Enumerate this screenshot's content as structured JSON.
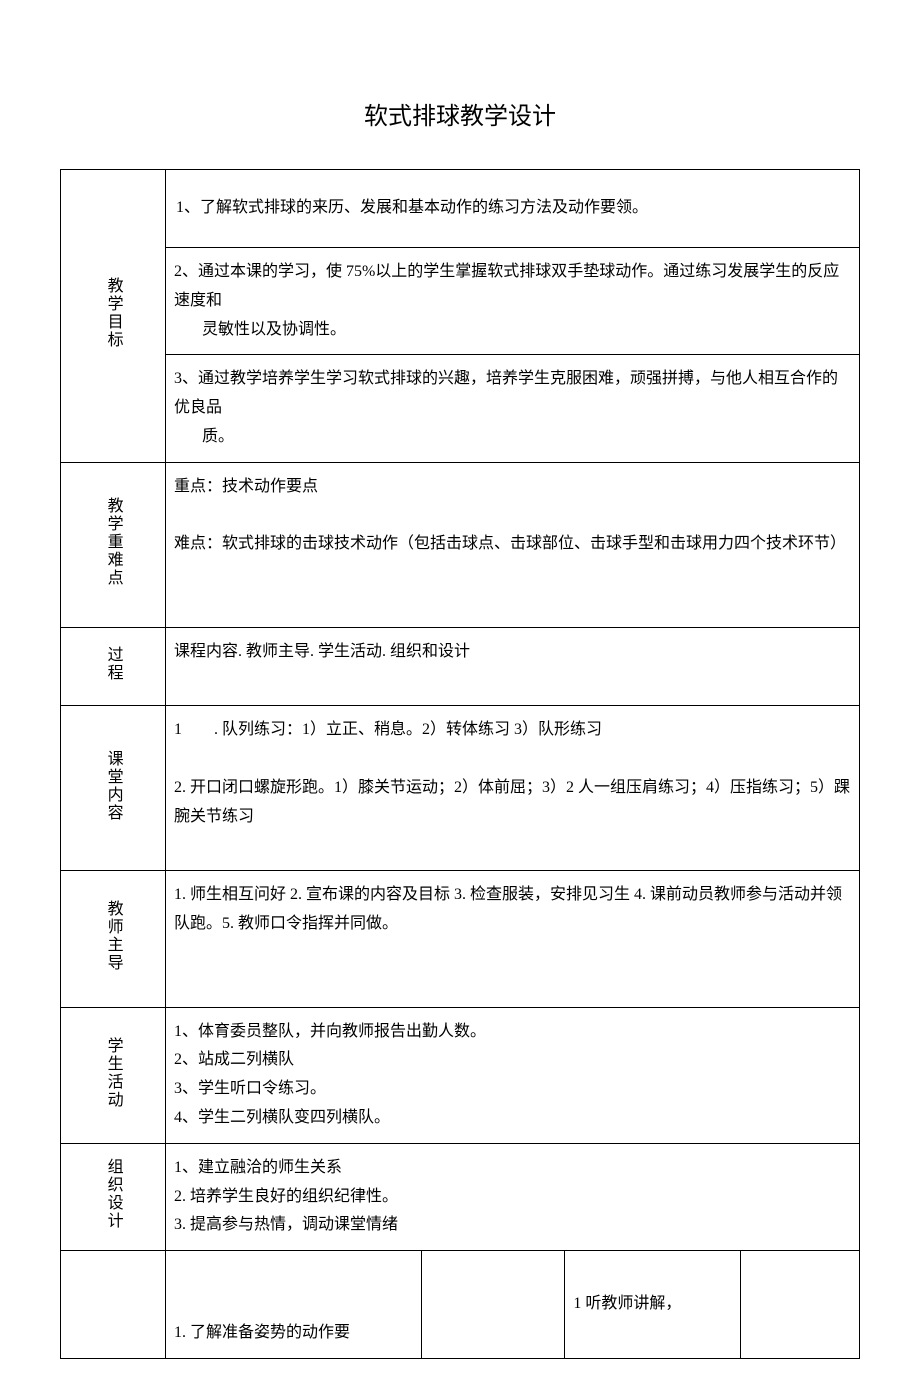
{
  "title": "软式排球教学设计",
  "rows": {
    "goal_label": "教学目标",
    "goal_1": "1、了解软式排球的来历、发展和基本动作的练习方法及动作要领。",
    "goal_2_a": "2、通过本课的学习，使 75%以上的学生掌握软式排球双手垫球动作。通过练习发展学生的反应速度和",
    "goal_2_b": "灵敏性以及协调性。",
    "goal_3_a": "3、通过教学培养学生学习软式排球的兴趣，培养学生克服困难，顽强拼搏，与他人相互合作的优良品",
    "goal_3_b": "质。",
    "keypoint_label": "教学重难点",
    "keypoint_1": "重点：技术动作要点",
    "keypoint_2": "难点：软式排球的击球技术动作（包括击球点、击球部位、击球手型和击球用力四个技术环节）",
    "process_label": "过程",
    "process_text": "课程内容. 教师主导. 学生活动. 组织和设计",
    "classcontent_label": "课堂内容",
    "classcontent_1": "1　　. 队列练习：1）立正、稍息。2）转体练习 3）队形练习",
    "classcontent_2": "2. 开口闭口螺旋形跑。1）膝关节运动；2）体前屈；3）2 人一组压肩练习；4）压指练习；5）踝腕关节练习",
    "teacher_label": "教师主导",
    "teacher_text": "1. 师生相互问好 2. 宣布课的内容及目标 3. 检查服装，安排见习生 4. 课前动员教师参与活动并领队跑。5. 教师口令指挥并同做。",
    "student_label": "学生活动",
    "student_1": "1、体育委员整队，并向教师报告出勤人数。",
    "student_2": "2、站成二列横队",
    "student_3": "3、学生听口令练习。",
    "student_4": "4、学生二列横队变四列横队。",
    "org_label": "组织设计",
    "org_1": "1、建立融洽的师生关系",
    "org_2": "2. 培养学生良好的组织纪律性。",
    "org_3": "3. 提高参与热情，调动课堂情绪",
    "bottom_left": "1. 了解准备姿势的动作要",
    "bottom_right": "1 听教师讲解，"
  }
}
